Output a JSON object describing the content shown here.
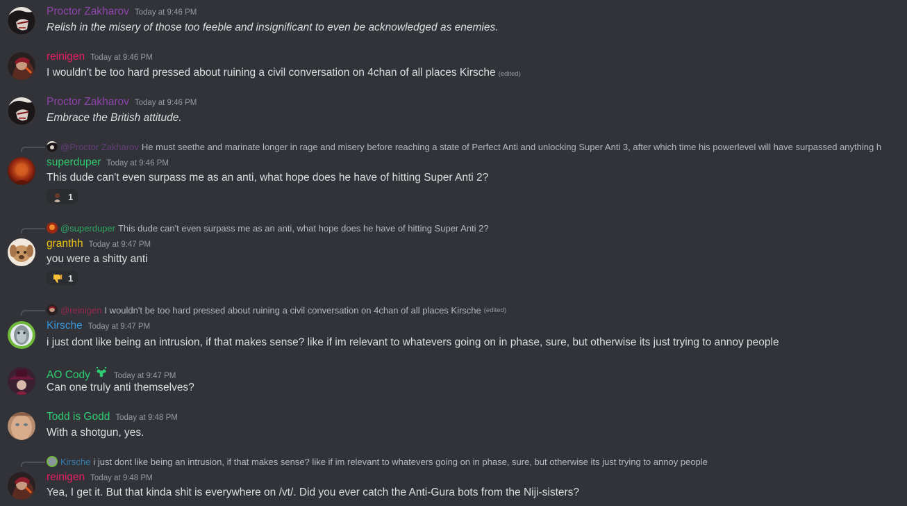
{
  "colors": {
    "background": "#313338",
    "proctor": "#8e44ad",
    "reinigen": "#e91e63",
    "superduper": "#2ecc71",
    "granthh": "#f1c40f",
    "kirsche": "#3498db",
    "aocody": "#2ecc71",
    "todd": "#2ecc71",
    "timestamp": "#949ba4",
    "text": "#dbdee1"
  },
  "messages": [
    {
      "username": "Proctor Zakharov",
      "timestamp": "Today at 9:46 PM",
      "content": "Relish in the misery of those too feeble and insignificant to even be acknowledged as enemies.",
      "avatar": "proctor-avatar"
    },
    {
      "username": "reinigen",
      "timestamp": "Today at 9:46 PM",
      "content": "I wouldn't be too hard pressed about ruining a civil conversation on 4chan of all places Kirsche",
      "edited": "(edited)",
      "avatar": "reinigen-avatar"
    },
    {
      "username": "Proctor Zakharov",
      "timestamp": "Today at 9:46 PM",
      "content": "Embrace the British attitude.",
      "avatar": "proctor-avatar"
    },
    {
      "reply": {
        "mention": "@Proctor Zakharov",
        "text": "He must seethe and marinate longer in rage and misery before reaching a state of Perfect Anti and unlocking Super Anti 3, after which time his powerlevel will have surpassed anything h"
      },
      "username": "superduper",
      "timestamp": "Today at 9:46 PM",
      "content": "This dude can't even surpass me as an anti, what hope does he have of hitting Super Anti 2?",
      "reaction": {
        "emoji": "person-emoji",
        "count": "1"
      },
      "avatar": "superduper-avatar"
    },
    {
      "reply": {
        "mention": "@superduper",
        "text": "This dude can't even surpass me as an anti, what hope does he have of hitting Super Anti 2?"
      },
      "username": "granthh",
      "timestamp": "Today at 9:47 PM",
      "content": "you were a shitty anti",
      "reaction": {
        "emoji": "thumbs-down-emoji",
        "count": "1"
      },
      "avatar": "granthh-avatar"
    },
    {
      "reply": {
        "mention": "@reinigen",
        "text": "I wouldn't be too hard pressed about ruining a civil conversation on 4chan of all places Kirsche",
        "edited": "(edited)"
      },
      "username": "Kirsche",
      "timestamp": "Today at 9:47 PM",
      "content": "i just dont like being an intrusion, if that makes sense? like if im relevant to whatevers going on in phase, sure, but otherwise its just trying to annoy people",
      "avatar": "kirsche-avatar"
    },
    {
      "username": "AO Cody",
      "timestamp": "Today at 9:47 PM",
      "content": "Can one truly anti themselves?",
      "badge": "clover-badge-icon",
      "avatar": "aocody-avatar"
    },
    {
      "username": "Todd is Godd",
      "timestamp": "Today at 9:48 PM",
      "content": "With a shotgun, yes.",
      "avatar": "todd-avatar"
    },
    {
      "reply": {
        "mention": "Kirsche",
        "text": "i just dont like being an intrusion, if that makes sense? like if im relevant to whatevers going on in phase, sure, but otherwise its just trying to annoy people"
      },
      "username": "reinigen",
      "timestamp": "Today at 9:48 PM",
      "content": "Yea, I get it. But that kinda shit is everywhere on /vt/. Did you ever catch the Anti-Gura bots from the Niji-sisters?",
      "avatar": "reinigen-avatar"
    }
  ]
}
